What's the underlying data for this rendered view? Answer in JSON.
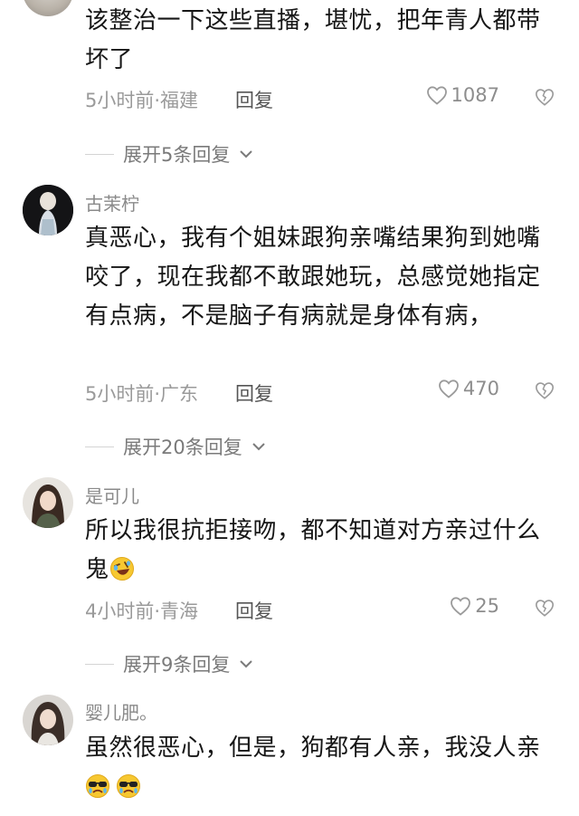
{
  "comments": [
    {
      "content": "该整治一下这些直播，堪忧，把年青人都带坏了",
      "meta": "5小时前·福建",
      "reply": "回复",
      "likes": "1087",
      "expand": "展开5条回复"
    },
    {
      "username": "古茉柠",
      "content": "真恶心，我有个姐妹跟狗亲嘴结果狗到她嘴咬了，现在我都不敢跟她玩，总感觉她指定有点病，不是脑子有病就是身体有病，",
      "meta": "5小时前·广东",
      "reply": "回复",
      "likes": "470",
      "expand": "展开20条回复"
    },
    {
      "username": "是可儿",
      "content": "所以我很抗拒接吻，都不知道对方亲过什么鬼",
      "emoji": "rolling-laughing-emoji",
      "meta": "4小时前·青海",
      "reply": "回复",
      "likes": "25",
      "expand": "展开9条回复"
    },
    {
      "username": "婴儿肥。",
      "content": "虽然很恶心，但是，狗都有人亲，我没人亲",
      "emoji": "sunglasses-crying-emoji"
    }
  ],
  "icons": {
    "heart": "heart-outline-icon",
    "dislike": "broken-heart-icon",
    "chevron": "chevron-down-icon"
  },
  "colors": {
    "text": "#161616",
    "muted": "#9a9a9a",
    "reply": "#555555",
    "emoji": "#f7c831"
  }
}
